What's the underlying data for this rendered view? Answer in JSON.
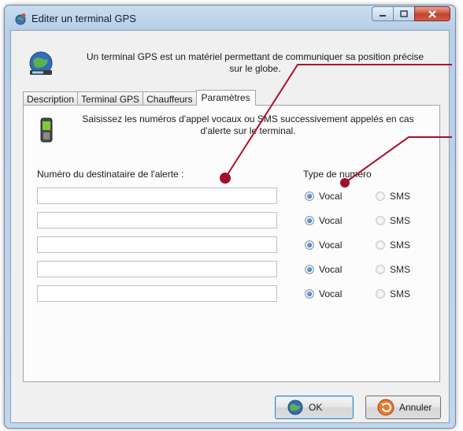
{
  "window": {
    "title": "Editer un terminal GPS",
    "caption_buttons": [
      "minimize-icon",
      "maximize-icon",
      "close-icon"
    ]
  },
  "intro_text": "Un terminal GPS est un matériel permettant de communiquer sa position précise sur le globe.",
  "tabs": [
    {
      "label": "Description",
      "active": false
    },
    {
      "label": "Terminal GPS",
      "active": false
    },
    {
      "label": "Chauffeurs",
      "active": false
    },
    {
      "label": "Paramètres",
      "active": true
    }
  ],
  "panel": {
    "info_text": "Saisissez les numéros d'appel vocaux ou SMS successivement appelés en cas d'alerte sur le terminal.",
    "number_label": "Numéro du destinataire de l'alerte :",
    "type_label": "Type de numéro",
    "rows": [
      {
        "number": "",
        "vocal_label": "Vocal",
        "sms_label": "SMS",
        "selected": "Vocal"
      },
      {
        "number": "",
        "vocal_label": "Vocal",
        "sms_label": "SMS",
        "selected": "Vocal"
      },
      {
        "number": "",
        "vocal_label": "Vocal",
        "sms_label": "SMS",
        "selected": "Vocal"
      },
      {
        "number": "",
        "vocal_label": "Vocal",
        "sms_label": "SMS",
        "selected": "Vocal"
      },
      {
        "number": "",
        "vocal_label": "Vocal",
        "sms_label": "SMS",
        "selected": "Vocal"
      }
    ]
  },
  "buttons": {
    "ok_label": "OK",
    "cancel_label": "Annuler"
  },
  "colors": {
    "annotation": "#a0102a",
    "accent": "#1e5aa5"
  }
}
